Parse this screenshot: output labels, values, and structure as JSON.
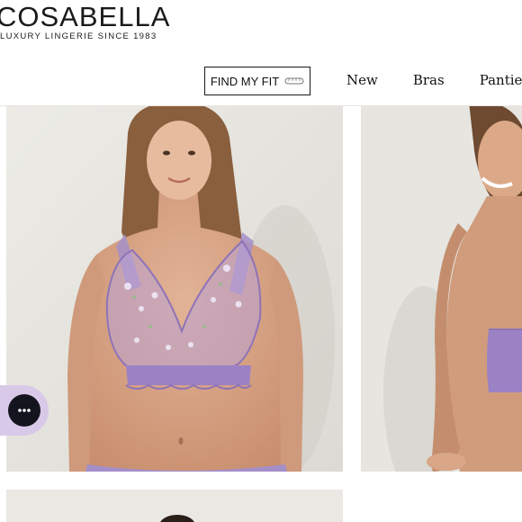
{
  "brand": {
    "name": "COSABELLA",
    "tagline": "LUXURY LINGERIE SINCE 1983"
  },
  "header": {
    "fit_button_label": "FIND MY FIT",
    "nav": [
      {
        "label": "New"
      },
      {
        "label": "Bras"
      },
      {
        "label": "Panties"
      }
    ]
  },
  "products": [
    {
      "description_icon": "lavender-embroidered-bralette-front"
    },
    {
      "description_icon": "lavender-bralette-back"
    },
    {
      "description_icon": "product-photo"
    },
    {
      "description_icon": "blank"
    }
  ],
  "colors": {
    "accent_lavender": "#a58fc9",
    "chat_bg": "#d9c9e8",
    "chat_inner": "#14141f"
  }
}
